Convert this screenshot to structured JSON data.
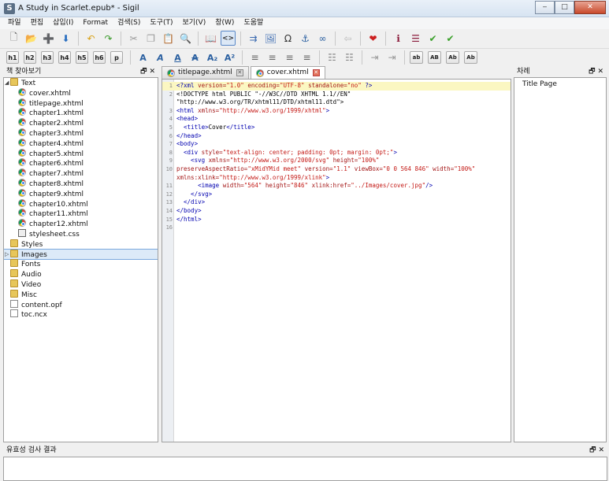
{
  "window": {
    "title": "A Study in Scarlet.epub* - Sigil",
    "app_icon": "S",
    "min": "‒",
    "max": "□",
    "close": "✕"
  },
  "menu": [
    "파일",
    "편집",
    "삽입(I)",
    "Format",
    "검색(S)",
    "도구(T)",
    "보기(V)",
    "창(W)",
    "도움말"
  ],
  "toolbar1": [
    {
      "name": "new-icon",
      "glyph": "🗋",
      "color": "#666"
    },
    {
      "name": "open-icon",
      "glyph": "📂",
      "color": "#c89a2c"
    },
    {
      "name": "add-icon",
      "glyph": "➕",
      "color": "#2a6fc0"
    },
    {
      "name": "save-icon",
      "glyph": "⬇",
      "color": "#2a6fc0"
    },
    {
      "sep": true
    },
    {
      "name": "undo-icon",
      "glyph": "↶",
      "color": "#d9a21a"
    },
    {
      "name": "redo-icon",
      "glyph": "↷",
      "color": "#3a9a2a"
    },
    {
      "sep": true
    },
    {
      "name": "cut-icon",
      "glyph": "✂",
      "color": "#999"
    },
    {
      "name": "copy-icon",
      "glyph": "❐",
      "color": "#999"
    },
    {
      "name": "paste-icon",
      "glyph": "📋",
      "color": "#b58a3a"
    },
    {
      "name": "find-icon",
      "glyph": "🔍",
      "color": "#555"
    },
    {
      "sep": true
    },
    {
      "name": "book-view-icon",
      "glyph": "📖",
      "color": "#333"
    },
    {
      "name": "code-view-icon",
      "glyph": "<>",
      "color": "#333",
      "active": true
    },
    {
      "sep": true
    },
    {
      "name": "split-icon",
      "glyph": "⇉",
      "color": "#3a6ab0"
    },
    {
      "name": "insert-image-icon",
      "glyph": "🖼",
      "color": "#3a6ab0"
    },
    {
      "name": "insert-special-char-icon",
      "glyph": "Ω",
      "color": "#333"
    },
    {
      "name": "anchor-icon",
      "glyph": "⚓",
      "color": "#2a5fa0"
    },
    {
      "name": "link-icon",
      "glyph": "∞",
      "color": "#2a5fa0"
    },
    {
      "sep": true
    },
    {
      "name": "back-icon",
      "glyph": "⇦",
      "color": "#bbb"
    },
    {
      "sep": true
    },
    {
      "name": "heart-icon",
      "glyph": "❤",
      "color": "#cc1f1f"
    },
    {
      "sep": true
    },
    {
      "name": "metadata-icon",
      "glyph": "ℹ",
      "color": "#8a1a3a"
    },
    {
      "name": "toc-icon",
      "glyph": "☰",
      "color": "#8a1a3a"
    },
    {
      "name": "spellcheck-icon",
      "glyph": "✔",
      "color": "#3aa02a"
    },
    {
      "name": "validate-icon",
      "glyph": "✔",
      "color": "#3aa02a"
    }
  ],
  "toolbar2": {
    "headings": [
      "h1",
      "h2",
      "h3",
      "h4",
      "h5",
      "h6",
      "p"
    ],
    "format": [
      {
        "name": "bold-icon",
        "glyph": "A",
        "color": "#2a5fa0"
      },
      {
        "name": "italic-icon",
        "glyph": "A",
        "color": "#2a5fa0"
      },
      {
        "name": "underline-icon",
        "glyph": "A",
        "color": "#2a5fa0"
      },
      {
        "name": "strikethrough-icon",
        "glyph": "A",
        "color": "#2a5fa0"
      },
      {
        "name": "subscript-icon",
        "glyph": "A₂",
        "color": "#2a5fa0"
      },
      {
        "name": "superscript-icon",
        "glyph": "A²",
        "color": "#2a5fa0"
      }
    ],
    "align": [
      "align-left-icon",
      "align-center-icon",
      "align-right-icon",
      "justify-icon"
    ],
    "lists": [
      "numbered-list-icon",
      "bullet-list-icon"
    ],
    "indent": [
      "decrease-indent-icon",
      "increase-indent-icon"
    ],
    "case": [
      "ab",
      "AB",
      "Ab",
      "Ab"
    ]
  },
  "book_browser": {
    "title": "책 찾아보기",
    "controls": "🗗 ✕",
    "items": [
      {
        "label": "Text",
        "type": "folder",
        "indent": 0,
        "expanded": true
      },
      {
        "label": "cover.xhtml",
        "type": "chrome",
        "indent": 1
      },
      {
        "label": "titlepage.xhtml",
        "type": "chrome",
        "indent": 1
      },
      {
        "label": "chapter1.xhtml",
        "type": "chrome",
        "indent": 1
      },
      {
        "label": "chapter2.xhtml",
        "type": "chrome",
        "indent": 1
      },
      {
        "label": "chapter3.xhtml",
        "type": "chrome",
        "indent": 1
      },
      {
        "label": "chapter4.xhtml",
        "type": "chrome",
        "indent": 1
      },
      {
        "label": "chapter5.xhtml",
        "type": "chrome",
        "indent": 1
      },
      {
        "label": "chapter6.xhtml",
        "type": "chrome",
        "indent": 1
      },
      {
        "label": "chapter7.xhtml",
        "type": "chrome",
        "indent": 1
      },
      {
        "label": "chapter8.xhtml",
        "type": "chrome",
        "indent": 1
      },
      {
        "label": "chapter9.xhtml",
        "type": "chrome",
        "indent": 1
      },
      {
        "label": "chapter10.xhtml",
        "type": "chrome",
        "indent": 1
      },
      {
        "label": "chapter11.xhtml",
        "type": "chrome",
        "indent": 1
      },
      {
        "label": "chapter12.xhtml",
        "type": "chrome",
        "indent": 1
      },
      {
        "label": "stylesheet.css",
        "type": "css",
        "indent": 1
      },
      {
        "label": "Styles",
        "type": "folder",
        "indent": 0
      },
      {
        "label": "Images",
        "type": "folder",
        "indent": 0,
        "selected": true,
        "collapsed": true
      },
      {
        "label": "Fonts",
        "type": "folder",
        "indent": 0
      },
      {
        "label": "Audio",
        "type": "folder",
        "indent": 0
      },
      {
        "label": "Video",
        "type": "folder",
        "indent": 0
      },
      {
        "label": "Misc",
        "type": "folder",
        "indent": 0
      },
      {
        "label": "content.opf",
        "type": "file",
        "indent": 0
      },
      {
        "label": "toc.ncx",
        "type": "file",
        "indent": 0
      }
    ]
  },
  "tabs": [
    {
      "label": "titlepage.xhtml",
      "active": false
    },
    {
      "label": "cover.xhtml",
      "active": true
    }
  ],
  "code_colors": {
    "tag": "#0000b0",
    "attr": "#a31515",
    "value": "#c41a16",
    "text": "#000000"
  },
  "code_lines": [
    {
      "n": "1",
      "hl": true,
      "parts": [
        [
          "<?xml ",
          "tag"
        ],
        [
          "version=",
          "attr"
        ],
        [
          "\"1.0\" ",
          "value"
        ],
        [
          "encoding=",
          "attr"
        ],
        [
          "\"UTF-8\" ",
          "value"
        ],
        [
          "standalone=",
          "attr"
        ],
        [
          "\"no\" ",
          "value"
        ],
        [
          "?>",
          "tag"
        ]
      ]
    },
    {
      "n": "2",
      "parts": [
        [
          "<!DOCTYPE html PUBLIC \"-//W3C//DTD XHTML 1.1//EN\"",
          "text"
        ]
      ]
    },
    {
      "n": "",
      "parts": [
        [
          "\"http://www.w3.org/TR/xhtml11/DTD/xhtml11.dtd\">",
          "text"
        ]
      ]
    },
    {
      "n": "3",
      "parts": [
        [
          "<html ",
          "tag"
        ],
        [
          "xmlns=",
          "attr"
        ],
        [
          "\"http://www.w3.org/1999/xhtml\"",
          "value"
        ],
        [
          ">",
          "tag"
        ]
      ]
    },
    {
      "n": "4",
      "parts": [
        [
          "<head>",
          "tag"
        ]
      ]
    },
    {
      "n": "5",
      "parts": [
        [
          "  <title>",
          "tag"
        ],
        [
          "Cover",
          "text"
        ],
        [
          "</title>",
          "tag"
        ]
      ]
    },
    {
      "n": "6",
      "parts": [
        [
          "</head>",
          "tag"
        ]
      ]
    },
    {
      "n": "7",
      "parts": [
        [
          "<body>",
          "tag"
        ]
      ]
    },
    {
      "n": "8",
      "parts": [
        [
          "  <div ",
          "tag"
        ],
        [
          "style=",
          "attr"
        ],
        [
          "\"text-align: center; padding: 0pt; margin: 0pt;\"",
          "value"
        ],
        [
          ">",
          "tag"
        ]
      ]
    },
    {
      "n": "9",
      "parts": [
        [
          "    <svg ",
          "tag"
        ],
        [
          "xmlns=",
          "attr"
        ],
        [
          "\"http://www.w3.org/2000/svg\" ",
          "value"
        ],
        [
          "height=",
          "attr"
        ],
        [
          "\"100%\"",
          "value"
        ]
      ]
    },
    {
      "n": "10",
      "parts": [
        [
          "preserveAspectRatio=",
          "attr"
        ],
        [
          "\"xMidYMid meet\" ",
          "value"
        ],
        [
          "version=",
          "attr"
        ],
        [
          "\"1.1\" ",
          "value"
        ],
        [
          "viewBox=",
          "attr"
        ],
        [
          "\"0 0 564 846\" ",
          "value"
        ],
        [
          "width=",
          "attr"
        ],
        [
          "\"100%\"",
          "value"
        ]
      ]
    },
    {
      "n": "",
      "parts": [
        [
          "xmlns:xlink=",
          "attr"
        ],
        [
          "\"http://www.w3.org/1999/xlink\"",
          "value"
        ],
        [
          ">",
          "tag"
        ]
      ]
    },
    {
      "n": "11",
      "parts": [
        [
          "      <image ",
          "tag"
        ],
        [
          "width=",
          "attr"
        ],
        [
          "\"564\" ",
          "value"
        ],
        [
          "height=",
          "attr"
        ],
        [
          "\"846\" ",
          "value"
        ],
        [
          "xlink:href=",
          "attr"
        ],
        [
          "\"../Images/cover.jpg\"",
          "value"
        ],
        [
          "/>",
          "tag"
        ]
      ]
    },
    {
      "n": "12",
      "parts": [
        [
          "    </svg>",
          "tag"
        ]
      ]
    },
    {
      "n": "13",
      "parts": [
        [
          "  </div>",
          "tag"
        ]
      ]
    },
    {
      "n": "14",
      "parts": [
        [
          "</body>",
          "tag"
        ]
      ]
    },
    {
      "n": "15",
      "parts": [
        [
          "</html>",
          "tag"
        ]
      ]
    },
    {
      "n": "16",
      "parts": []
    }
  ],
  "toc": {
    "title": "차례",
    "controls": "🗗 ✕",
    "items": [
      "Title Page"
    ]
  },
  "validation": {
    "title": "유효성 검사 결과",
    "controls": "🗗 ✕"
  }
}
